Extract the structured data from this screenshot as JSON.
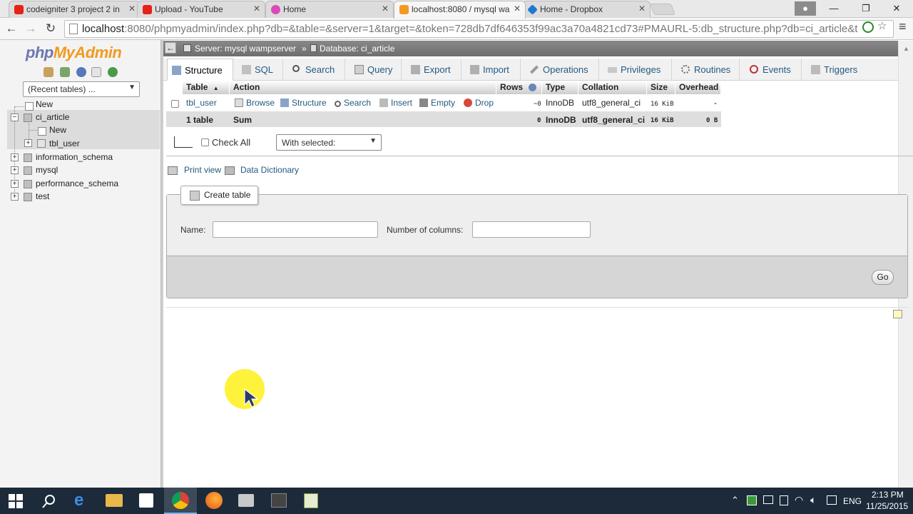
{
  "browser": {
    "tabs": [
      {
        "label": "codeigniter 3 project 2 in",
        "icon": "youtube-icon",
        "color": "#e62117"
      },
      {
        "label": "Upload - YouTube",
        "icon": "youtube-icon",
        "color": "#e62117"
      },
      {
        "label": "Home",
        "icon": "home-app-icon",
        "color": "#d94ab8"
      },
      {
        "label": "localhost:8080 / mysql wa",
        "icon": "pma-icon",
        "color": "#f29a20"
      },
      {
        "label": "Home - Dropbox",
        "icon": "dropbox-icon",
        "color": "#1f78d1"
      }
    ],
    "url_host": "localhost",
    "url_path": ":8080/phpmyadmin/index.php?db=&table=&server=1&target=&token=728db7df646353f99ac3a70a4821cd73#PMAURL-5:db_structure.php?db=ci_article&t"
  },
  "sidebar": {
    "logo_php": "php",
    "logo_my": "MyAdmin",
    "recent_tables": "(Recent tables) ...",
    "tree": {
      "new": "New",
      "ci_article": "ci_article",
      "ci_new": "New",
      "tbl_user": "tbl_user",
      "information_schema": "information_schema",
      "mysql": "mysql",
      "performance_schema": "performance_schema",
      "test": "test"
    }
  },
  "breadcrumb": {
    "server": "Server: mysql wampserver",
    "sep": "»",
    "database": "Database: ci_article"
  },
  "tabs": {
    "structure": "Structure",
    "sql": "SQL",
    "search": "Search",
    "query": "Query",
    "export": "Export",
    "import": "Import",
    "operations": "Operations",
    "privileges": "Privileges",
    "routines": "Routines",
    "events": "Events",
    "triggers": "Triggers"
  },
  "table": {
    "headers": {
      "table": "Table",
      "action": "Action",
      "rows": "Rows",
      "type": "Type",
      "collation": "Collation",
      "size": "Size",
      "overhead": "Overhead"
    },
    "row": {
      "name": "tbl_user",
      "browse": "Browse",
      "structure": "Structure",
      "search": "Search",
      "insert": "Insert",
      "empty": "Empty",
      "drop": "Drop",
      "rows": "~0",
      "type": "InnoDB",
      "collation": "utf8_general_ci",
      "size": "16 KiB",
      "overhead": "-"
    },
    "sum": {
      "count": "1 table",
      "label": "Sum",
      "rows": "0",
      "type": "InnoDB",
      "collation": "utf8_general_ci",
      "size": "16 KiB",
      "overhead": "0 B"
    }
  },
  "bulk": {
    "check_all": "Check All",
    "with_selected": "With selected:"
  },
  "links": {
    "print_view": "Print view",
    "data_dictionary": "Data Dictionary"
  },
  "create_table": {
    "legend": "Create table",
    "name_label": "Name:",
    "columns_label": "Number of columns:",
    "go": "Go"
  },
  "taskbar": {
    "language": "ENG",
    "time": "2:13 PM",
    "date": "11/25/2015"
  }
}
